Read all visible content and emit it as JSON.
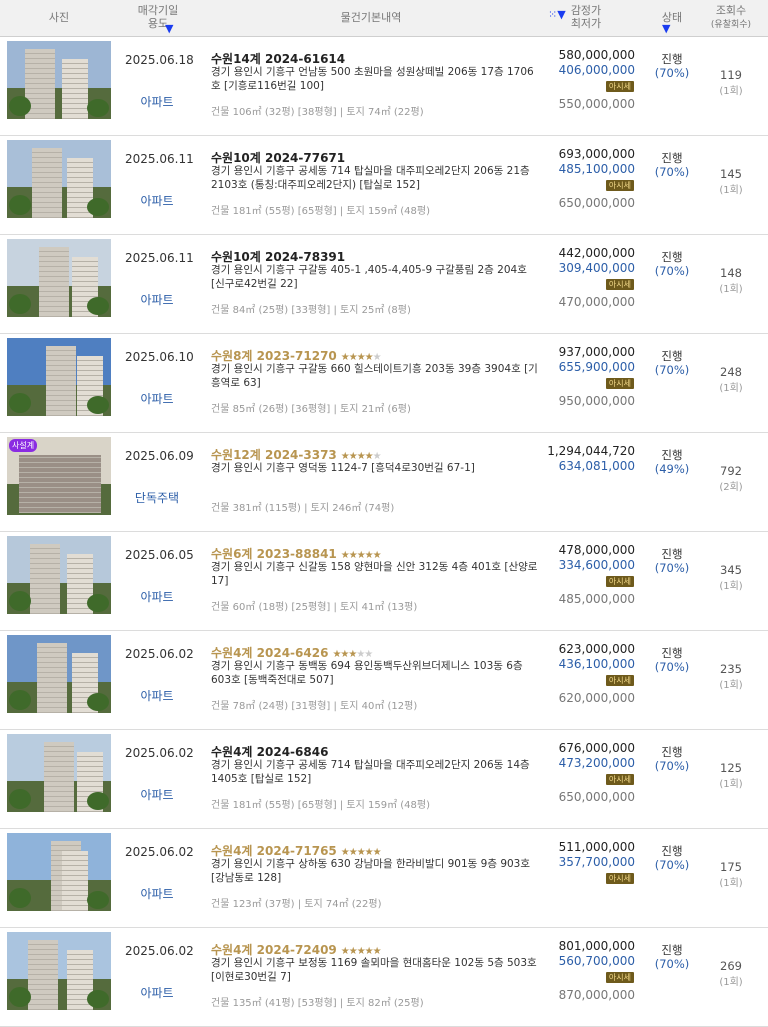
{
  "header": {
    "photo": "사진",
    "date_line1": "매각기일",
    "date_line2": "용도",
    "info": "물건기본내역",
    "price_line1": "감정가",
    "price_line2": "최저가",
    "status": "상태",
    "views_line1": "조회수",
    "views_line2": "(유찰회수)"
  },
  "colors": {
    "accent_blue": "#2c5ea8",
    "gold": "#b89550",
    "header_bg": "#f1f1f1"
  },
  "rows": [
    {
      "date": "2025.06.18",
      "use": "아파트",
      "case": "수원14계 2024-61614",
      "gold": false,
      "stars": 0,
      "addr": "경기 용인시 기흥구 언남동 500 초원마을 성원상떼빌 206동 17층 1706호 [기흥로116번길 100]",
      "area": "건물 106㎡ (32평) [38평형]  |  토지 74㎡ (22평)",
      "appraised": "580,000,000",
      "minimum": "406,000,000",
      "tag": "아시세",
      "prev": "550,000,000",
      "status": "진행",
      "rate": "(70%)",
      "views": "119",
      "fails": "(1회)",
      "badge": ""
    },
    {
      "date": "2025.06.11",
      "use": "아파트",
      "case": "수원10계 2024-77671",
      "gold": false,
      "stars": 0,
      "addr": "경기 용인시 기흥구 공세동 714 탑실마을 대주피오레2단지 206동 21층 2103호 (통칭:대주피오레2단지) [탑실로 152]",
      "area": "건물 181㎡ (55평) [65평형]  |  토지 159㎡ (48평)",
      "appraised": "693,000,000",
      "minimum": "485,100,000",
      "tag": "아시세",
      "prev": "650,000,000",
      "status": "진행",
      "rate": "(70%)",
      "views": "145",
      "fails": "(1회)",
      "badge": ""
    },
    {
      "date": "2025.06.11",
      "use": "아파트",
      "case": "수원10계 2024-78391",
      "gold": false,
      "stars": 0,
      "addr": "경기 용인시 기흥구 구갈동 405-1 ,405-4,405-9 구갈풍림 2층 204호 [신구로42번길 22]",
      "area": "건물 84㎡ (25평) [33평형]  |  토지 25㎡ (8평)",
      "appraised": "442,000,000",
      "minimum": "309,400,000",
      "tag": "아시세",
      "prev": "470,000,000",
      "status": "진행",
      "rate": "(70%)",
      "views": "148",
      "fails": "(1회)",
      "badge": ""
    },
    {
      "date": "2025.06.10",
      "use": "아파트",
      "case": "수원8계 2023-71270",
      "gold": true,
      "stars": 4,
      "addr": "경기 용인시 기흥구 구갈동 660 힐스테이트기흥 203동 39층 3904호 [기흥역로 63]",
      "area": "건물 85㎡ (26평) [36평형]  |  토지 21㎡ (6평)",
      "appraised": "937,000,000",
      "minimum": "655,900,000",
      "tag": "아시세",
      "prev": "950,000,000",
      "status": "진행",
      "rate": "(70%)",
      "views": "248",
      "fails": "(1회)",
      "badge": ""
    },
    {
      "date": "2025.06.09",
      "use": "단독주택",
      "case": "수원12계 2024-3373",
      "gold": true,
      "stars": 4,
      "addr": "경기 용인시 기흥구 영덕동 1124-7 [흥덕4로30번길 67-1]",
      "area": "건물 381㎡ (115평)  |  토지 246㎡ (74평)",
      "appraised": "1,294,044,720",
      "minimum": "634,081,000",
      "tag": "",
      "prev": "",
      "status": "진행",
      "rate": "(49%)",
      "views": "792",
      "fails": "(2회)",
      "badge": "사설계"
    },
    {
      "date": "2025.06.05",
      "use": "아파트",
      "case": "수원6계 2023-88841",
      "gold": true,
      "stars": 5,
      "addr": "경기 용인시 기흥구 신갈동 158 양현마을 신안 312동 4층 401호 [산양로 17]",
      "area": "건물 60㎡ (18평) [25평형]  |  토지 41㎡ (13평)",
      "appraised": "478,000,000",
      "minimum": "334,600,000",
      "tag": "아시세",
      "prev": "485,000,000",
      "status": "진행",
      "rate": "(70%)",
      "views": "345",
      "fails": "(1회)",
      "badge": ""
    },
    {
      "date": "2025.06.02",
      "use": "아파트",
      "case": "수원4계 2024-6426",
      "gold": true,
      "stars": 3,
      "addr": "경기 용인시 기흥구 동백동 694 용인동백두산위브더제니스 103동 6층 603호 [동백죽전대로 507]",
      "area": "건물 78㎡ (24평) [31평형]  |  토지 40㎡ (12평)",
      "appraised": "623,000,000",
      "minimum": "436,100,000",
      "tag": "아시세",
      "prev": "620,000,000",
      "status": "진행",
      "rate": "(70%)",
      "views": "235",
      "fails": "(1회)",
      "badge": ""
    },
    {
      "date": "2025.06.02",
      "use": "아파트",
      "case": "수원4계 2024-6846",
      "gold": false,
      "stars": 0,
      "addr": "경기 용인시 기흥구 공세동 714 탑실마을 대주피오레2단지 206동 14층 1405호 [탑실로 152]",
      "area": "건물 181㎡ (55평) [65평형]  |  토지 159㎡ (48평)",
      "appraised": "676,000,000",
      "minimum": "473,200,000",
      "tag": "아시세",
      "prev": "650,000,000",
      "status": "진행",
      "rate": "(70%)",
      "views": "125",
      "fails": "(1회)",
      "badge": ""
    },
    {
      "date": "2025.06.02",
      "use": "아파트",
      "case": "수원4계 2024-71765",
      "gold": true,
      "stars": 5,
      "addr": "경기 용인시 기흥구 상하동 630 강남마을 한라비발디 901동 9층 903호 [강남동로 128]",
      "area": "건물 123㎡ (37평)  |  토지 74㎡ (22평)",
      "appraised": "511,000,000",
      "minimum": "357,700,000",
      "tag": "아시세",
      "prev": "",
      "status": "진행",
      "rate": "(70%)",
      "views": "175",
      "fails": "(1회)",
      "badge": ""
    },
    {
      "date": "2025.06.02",
      "use": "아파트",
      "case": "수원4계 2024-72409",
      "gold": true,
      "stars": 5,
      "addr": "경기 용인시 기흥구 보정동 1169 솔뫼마을 현대홈타운 102동 5층 503호 [이현로30번길 7]",
      "area": "건물 135㎡ (41평) [53평형]  |  토지 82㎡ (25평)",
      "appraised": "801,000,000",
      "minimum": "560,700,000",
      "tag": "아시세",
      "prev": "870,000,000",
      "status": "진행",
      "rate": "(70%)",
      "views": "269",
      "fails": "(1회)",
      "badge": ""
    }
  ]
}
